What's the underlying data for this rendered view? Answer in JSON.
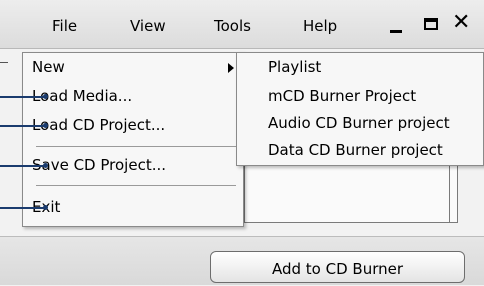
{
  "menubar": {
    "items": [
      "File",
      "View",
      "Tools",
      "Help"
    ]
  },
  "file_menu": {
    "items": [
      "New",
      "Load Media...",
      "Load CD Project...",
      "Save CD Project...",
      "Exit"
    ]
  },
  "new_submenu": {
    "items": [
      "Playlist",
      "mCD Burner Project",
      "Audio CD Burner project",
      "Data CD Burner project"
    ]
  },
  "bottom": {
    "add_button_label": "Add to CD Burner"
  },
  "icons": {
    "minimize": "minimize-icon",
    "maximize": "maximize-icon",
    "close": "close-icon",
    "submenu_arrow": "chevron-right-icon"
  },
  "colors": {
    "callout": "#1a3b6e"
  }
}
